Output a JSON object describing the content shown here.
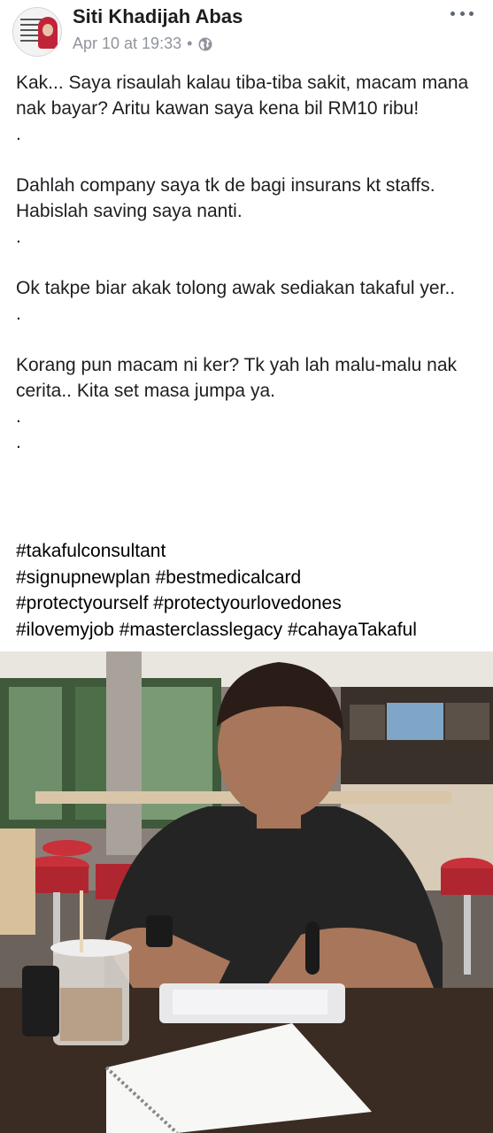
{
  "post": {
    "author": "Siti Khadijah Abas",
    "timestamp": "Apr 10 at 19:33",
    "separator": "•",
    "privacy_icon": "globe-icon",
    "more_icon": "more-options-icon",
    "paragraphs": [
      "Kak... Saya risaulah kalau tiba-tiba sakit, macam mana nak bayar? Aritu kawan saya kena bil RM10 ribu!",
      ".",
      "Dahlah company saya tk de bagi insurans kt staffs. Habislah saving saya nanti.",
      ".",
      "Ok takpe biar akak tolong awak sediakan takaful yer..",
      ".",
      "Korang pun macam ni ker? Tk yah lah malu-malu nak cerita.. Kita set masa jumpa ya.",
      ".",
      "."
    ],
    "hashtag_lines": [
      "#takafulconsultant",
      "#signupnewplan #bestmedicalcard",
      "#protectyourself #protectyourlovedones",
      "#ilovemyjob #masterclasslegacy #cahayaTakaful"
    ]
  },
  "colors": {
    "text": "#1c1e21",
    "meta": "#90949c",
    "stool_red": "#c8303a"
  }
}
